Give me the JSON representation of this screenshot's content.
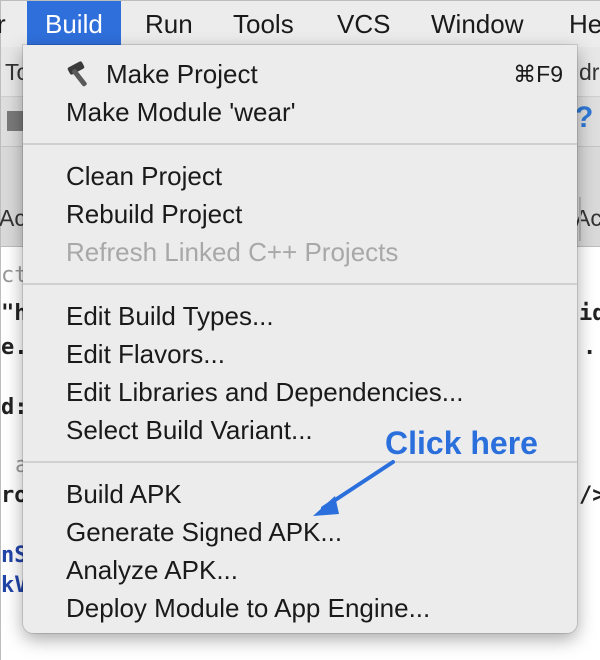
{
  "menubar": {
    "items": [
      {
        "label": "r"
      },
      {
        "label": "Build"
      },
      {
        "label": "Run"
      },
      {
        "label": "Tools"
      },
      {
        "label": "VCS"
      },
      {
        "label": "Window"
      },
      {
        "label": "He"
      }
    ]
  },
  "background": {
    "toolbar_left_text": "To",
    "toolbar_right_text": "dr",
    "tabs_left_text": "Ac",
    "tabs_right_text": "Ac",
    "editor_left_lines": [
      "ct",
      "\"h",
      "e.",
      "d:",
      "a",
      "ro",
      "nS",
      "kV"
    ],
    "editor_right_lines": [
      "id",
      ".",
      "/>"
    ],
    "help_icon": "question-icon"
  },
  "dropdown": {
    "groups": [
      [
        {
          "label": "Make Project",
          "shortcut": "⌘F9",
          "icon": "hammer-icon",
          "enabled": true
        },
        {
          "label": "Make Module 'wear'",
          "shortcut": "",
          "enabled": true
        }
      ],
      [
        {
          "label": "Clean Project",
          "enabled": true
        },
        {
          "label": "Rebuild Project",
          "enabled": true
        },
        {
          "label": "Refresh Linked C++ Projects",
          "enabled": false
        }
      ],
      [
        {
          "label": "Edit Build Types...",
          "enabled": true
        },
        {
          "label": "Edit Flavors...",
          "enabled": true
        },
        {
          "label": "Edit Libraries and Dependencies...",
          "enabled": true
        },
        {
          "label": "Select Build Variant...",
          "enabled": true
        }
      ],
      [
        {
          "label": "Build APK",
          "enabled": true
        },
        {
          "label": "Generate Signed APK...",
          "enabled": true
        },
        {
          "label": "Analyze APK...",
          "enabled": true
        },
        {
          "label": "Deploy Module to App Engine...",
          "enabled": true
        }
      ]
    ]
  },
  "annotation": {
    "text": "Click here",
    "color": "#2a6fdc"
  },
  "colors": {
    "menu_active": "#2f6fdb",
    "disabled_text": "#a8a8a8"
  }
}
